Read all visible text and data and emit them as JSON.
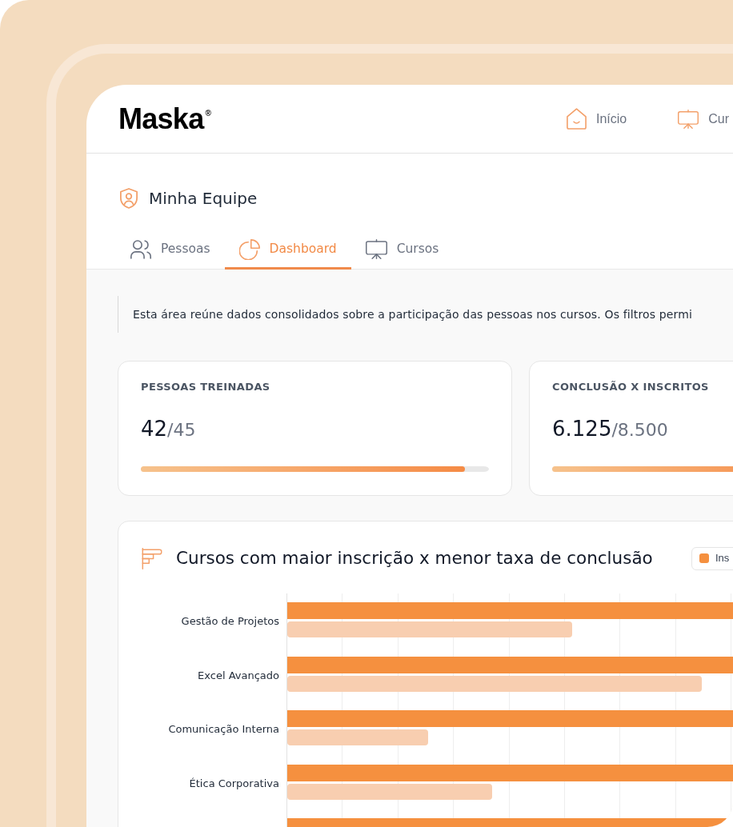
{
  "brand": {
    "name": "Maska$^{®}$"
  },
  "nav": [
    {
      "label": "Início",
      "kind": "home"
    },
    {
      "label": "Cur",
      "kind": "courses"
    }
  ],
  "page": {
    "title": "Minha Equipe"
  },
  "tabs": [
    {
      "label": "Pessoas",
      "kind": "people",
      "selected": false
    },
    {
      "label": "Dashboard",
      "kind": "chart",
      "selected": true
    },
    {
      "label": "Cursos",
      "kind": "courses",
      "selected": false
    }
  ],
  "description": "Esta área reúne dados consolidados sobre a participação das pessoas nos cursos. Os filtros permi",
  "stats": [
    {
      "label": "PESSOAS TREINADAS",
      "value": "42",
      "total": "/45",
      "level": 0.93
    },
    {
      "label": "CONCLUSÃO X INSCRITOS",
      "value": "6.125",
      "total": "/8.500",
      "level": 0.72
    }
  ],
  "chart": {
    "title": "Cursos com maior inscrição x menor taxa de conclusão",
    "legend": [
      {
        "label": "Ins",
        "color": "#f5903f"
      }
    ],
    "categories": [
      "Gestão de Projetos",
      "Excel Avançado",
      "Comunicação Interna",
      "Ética Corporativa"
    ]
  }
}
